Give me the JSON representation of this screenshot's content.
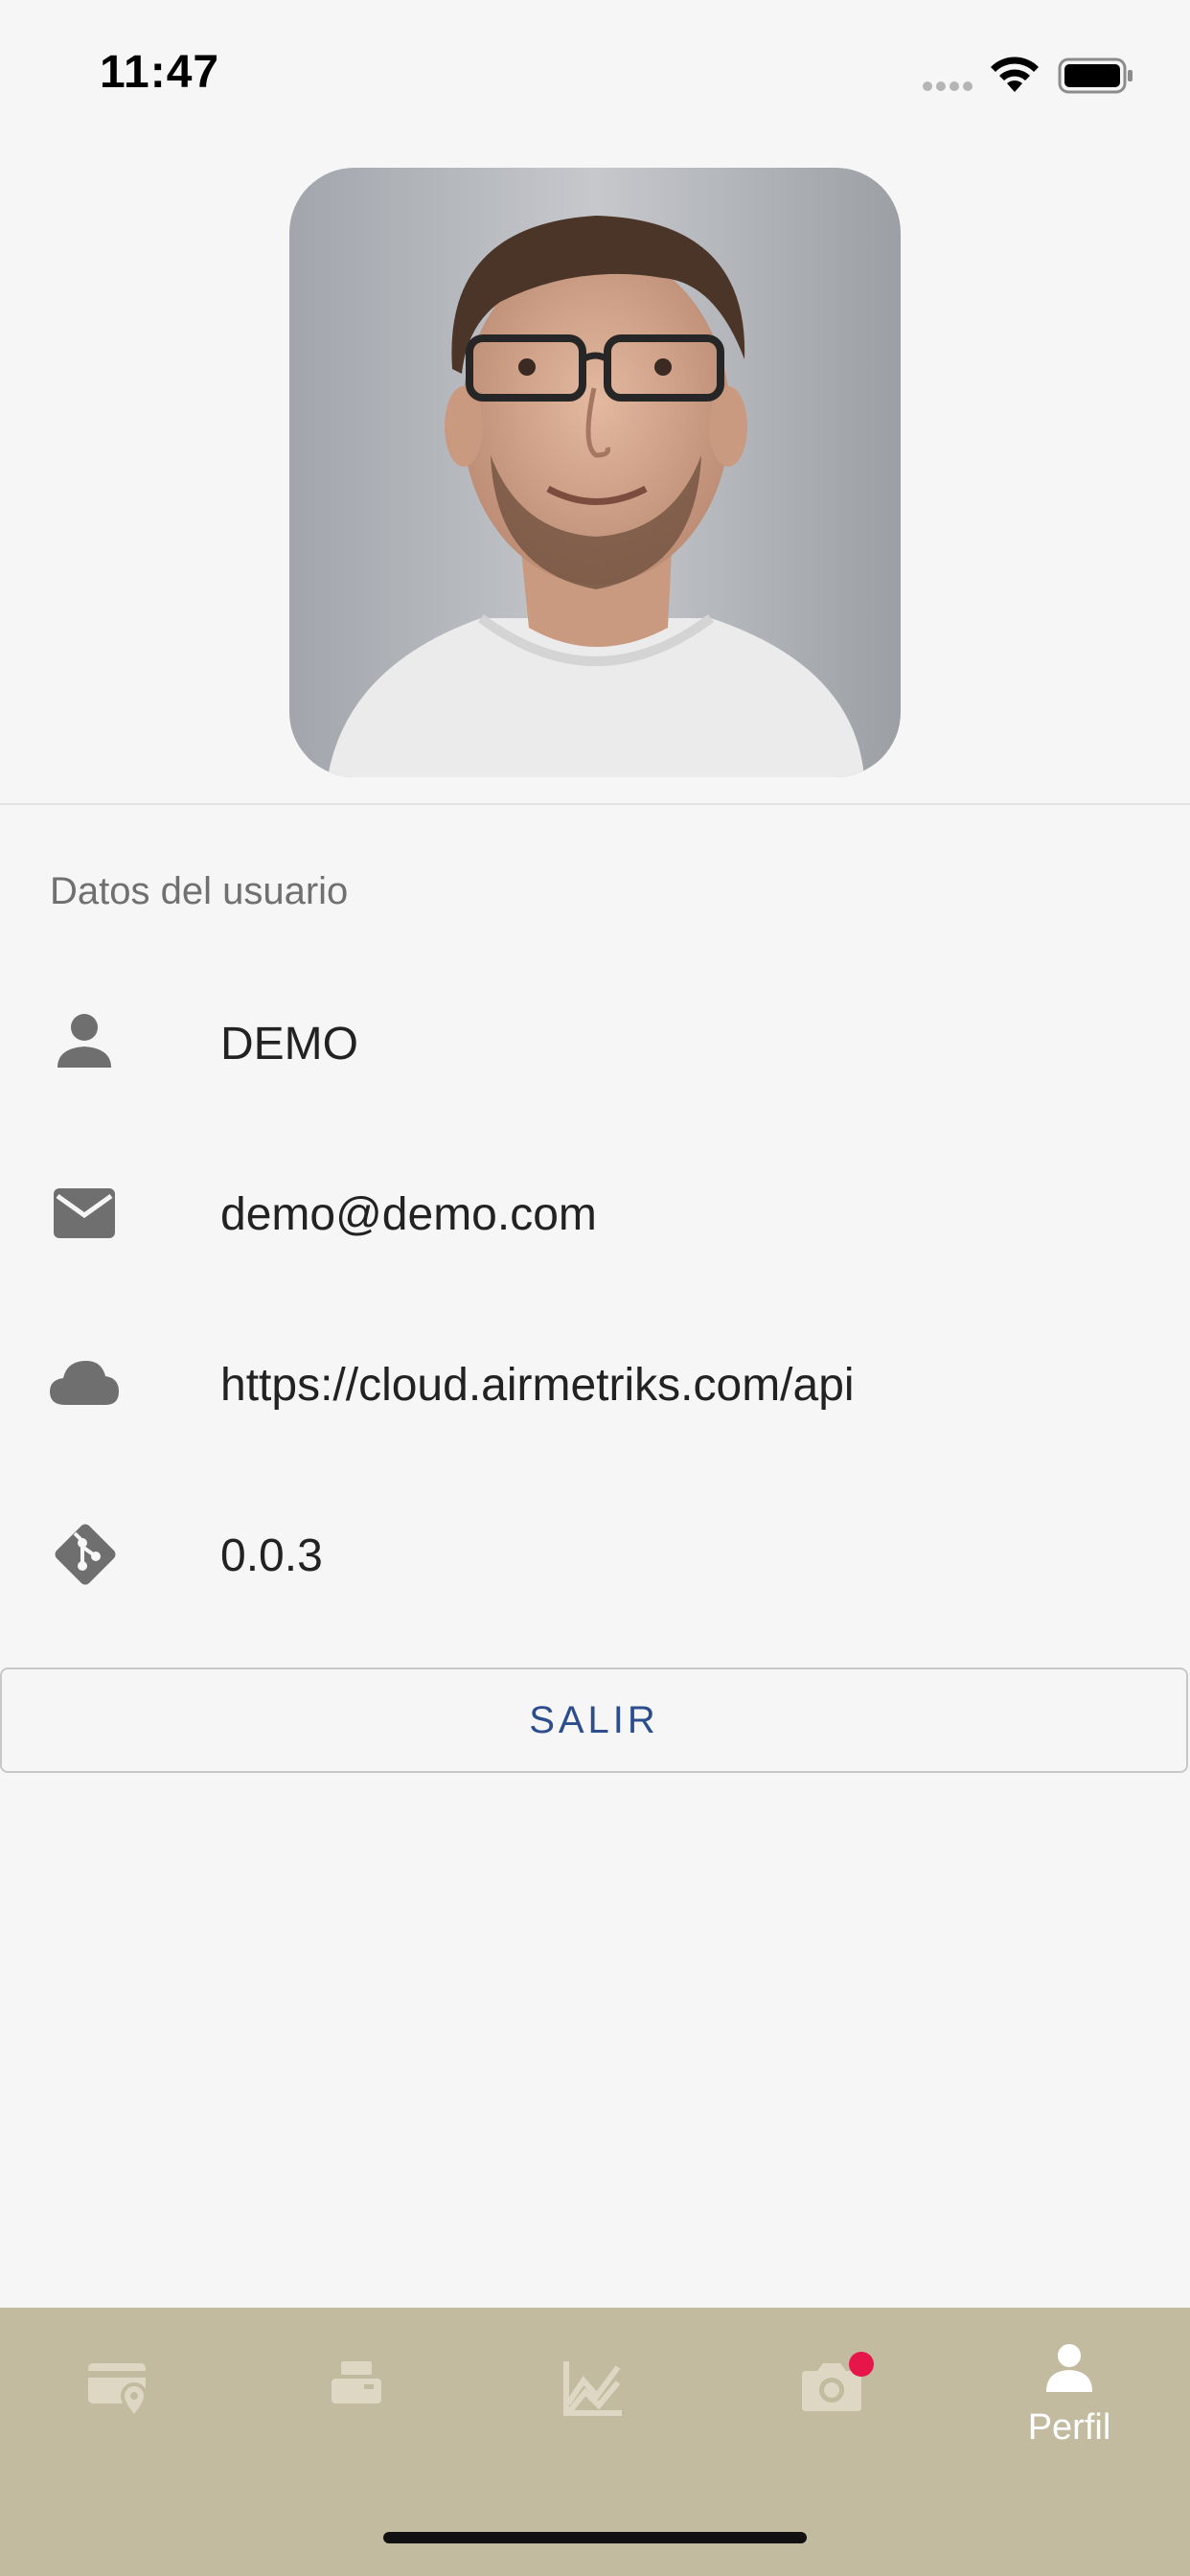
{
  "status_bar": {
    "time": "11:47"
  },
  "profile": {
    "avatar_alt": "avatar"
  },
  "section": {
    "title": "Datos del usuario"
  },
  "user_info": {
    "name": "DEMO",
    "email": "demo@demo.com",
    "server": "https://cloud.airmetriks.com/api",
    "version": "0.0.3"
  },
  "actions": {
    "logout_label": "SALIR"
  },
  "bottom_nav": {
    "items": [
      {
        "icon": "card-location-icon",
        "label": ""
      },
      {
        "icon": "printer-icon",
        "label": ""
      },
      {
        "icon": "chart-icon",
        "label": ""
      },
      {
        "icon": "camera-icon",
        "label": "",
        "badge": true
      },
      {
        "icon": "person-icon",
        "label": "Perfil",
        "active": true
      }
    ]
  },
  "colors": {
    "background": "#f6f6f6",
    "nav_background": "#c3bb9f",
    "nav_icon_inactive": "#ded7c3",
    "accent_text": "#2c4e8d",
    "badge": "#e6164a"
  }
}
